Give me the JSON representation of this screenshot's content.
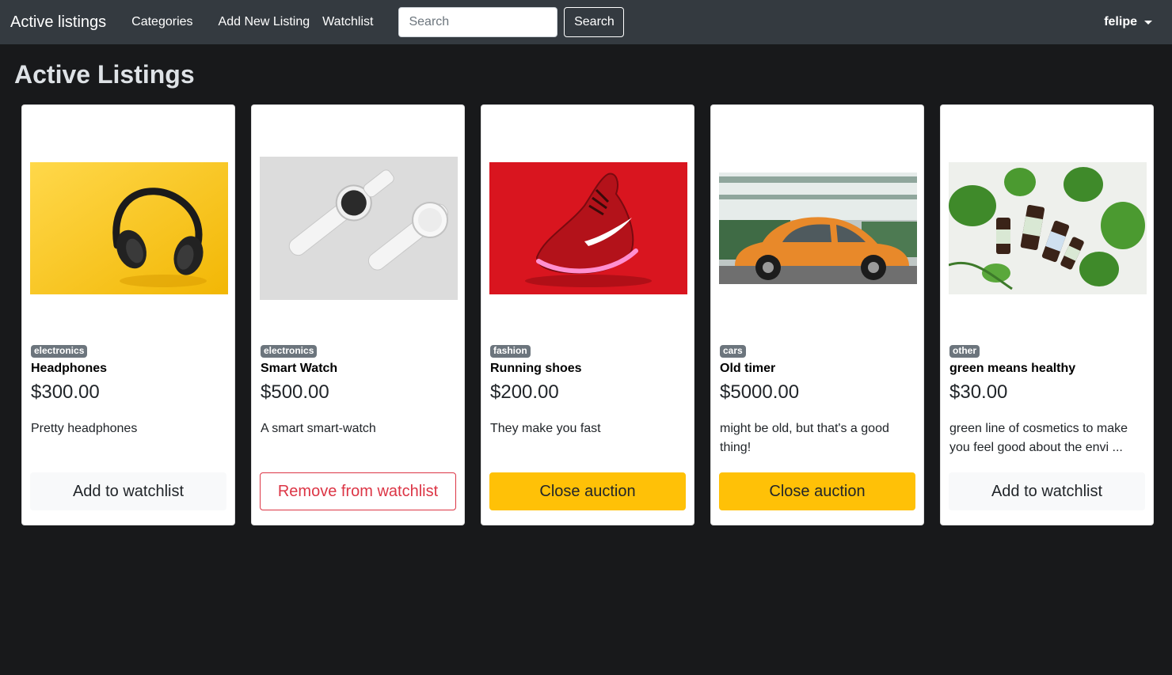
{
  "nav": {
    "brand": "Active listings",
    "links": [
      "Categories",
      "Add New Listing",
      "Watchlist"
    ],
    "search_placeholder": "Search",
    "search_button": "Search",
    "user": "felipe"
  },
  "page": {
    "title": "Active Listings"
  },
  "listings": [
    {
      "category": "electronics",
      "title": "Headphones",
      "price": "$300.00",
      "description": "Pretty headphones",
      "action": "Add to watchlist",
      "image_icon": "headphones-image"
    },
    {
      "category": "electronics",
      "title": "Smart Watch",
      "price": "$500.00",
      "description": "A smart smart-watch",
      "action": "Remove from watchlist",
      "image_icon": "smartwatch-image"
    },
    {
      "category": "fashion",
      "title": "Running shoes",
      "price": "$200.00",
      "description": "They make you fast",
      "action": "Close auction",
      "image_icon": "sneaker-image"
    },
    {
      "category": "cars",
      "title": "Old timer",
      "price": "$5000.00",
      "description": "might be old, but that's a good thing!",
      "action": "Close auction",
      "image_icon": "beetle-car-image"
    },
    {
      "category": "other",
      "title": "green means healthy",
      "price": "$30.00",
      "description": "green line of cosmetics to make you feel good about the envi ...",
      "action": "Add to watchlist",
      "image_icon": "cosmetics-bottles-image"
    }
  ],
  "colors": {
    "background": "#18191b",
    "navbar": "#343a40",
    "badge": "#6c757d",
    "warning": "#ffc107",
    "danger": "#dc3545",
    "light": "#f8f9fa"
  }
}
